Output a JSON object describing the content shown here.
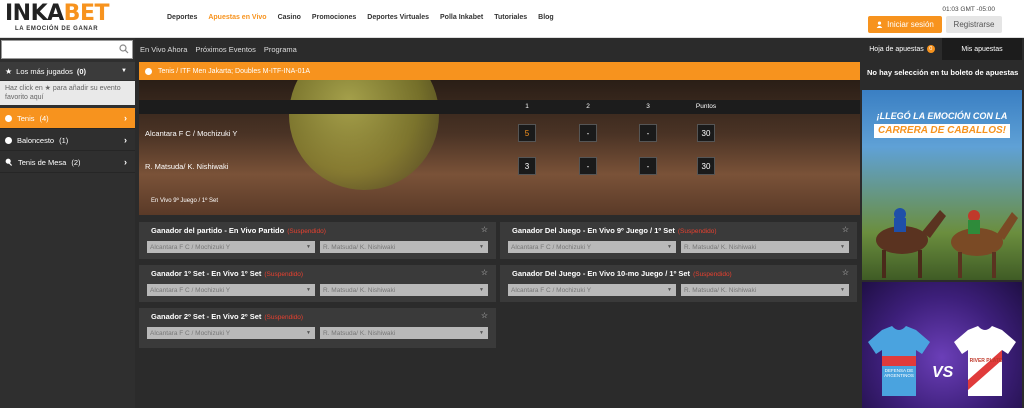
{
  "header": {
    "logo_main": "INKA",
    "logo_accent": "BET",
    "logo_tagline": "LA EMOCIÓN DE GANAR",
    "nav": [
      "Deportes",
      "Apuestas en Vivo",
      "Casino",
      "Promociones",
      "Deportes Virtuales",
      "Polla Inkabet",
      "Tutoriales",
      "Blog"
    ],
    "active_nav": "Apuestas en Vivo",
    "clock": "01:03 GMT -05:00",
    "login_label": "Iniciar sesión",
    "register_label": "Registrarse"
  },
  "sidebar": {
    "search_value": "",
    "most_played_label": "Los más jugados",
    "most_played_count": "(0)",
    "hint_text": "Haz click en ★ para añadir su evento favorito aquí",
    "sports": [
      {
        "label": "Tenis",
        "count": "(4)"
      },
      {
        "label": "Baloncesto",
        "count": "(1)"
      },
      {
        "label": "Tenis de Mesa",
        "count": "(2)"
      }
    ]
  },
  "subnav": [
    "En Vivo Ahora",
    "Próximos Eventos",
    "Programa"
  ],
  "event": {
    "title": "Tenis / ITF Men Jakarta; Doubles M-ITF-INA-01A",
    "columns": [
      "1",
      "2",
      "3",
      "Puntos"
    ],
    "players": [
      {
        "name": "Alcantara F C / Mochizuki Y",
        "scores": [
          "5",
          "-",
          "-",
          "30"
        ]
      },
      {
        "name": "R. Matsuda/ K. Nishiwaki",
        "scores": [
          "3",
          "-",
          "-",
          "30"
        ]
      }
    ],
    "live_status": "En Vivo 9º Juego / 1º Set"
  },
  "markets": [
    {
      "title": "Ganador del partido - En Vivo Partido",
      "status": "(Suspendido)",
      "options": [
        "Alcantara F C / Mochizuki Y",
        "R. Matsuda/ K. Nishiwaki"
      ]
    },
    {
      "title": "Ganador Del Juego - En Vivo 9º Juego / 1º Set",
      "status": "(Suspendido)",
      "options": [
        "Alcantara F C / Mochizuki Y",
        "R. Matsuda/ K. Nishiwaki"
      ]
    },
    {
      "title": "Ganador 1º Set - En Vivo 1º Set",
      "status": "(Suspendido)",
      "options": [
        "Alcantara F C / Mochizuki Y",
        "R. Matsuda/ K. Nishiwaki"
      ]
    },
    {
      "title": "Ganador Del Juego - En Vivo 10-mo Juego / 1º Set",
      "status": "(Suspendido)",
      "options": [
        "Alcantara F C / Mochizuki Y",
        "R. Matsuda/ K. Nishiwaki"
      ]
    },
    {
      "title": "Ganador 2º Set - En Vivo 2º Set",
      "status": "(Suspendido)",
      "options": [
        "Alcantara F C / Mochizuki Y",
        "R. Matsuda/ K. Nishiwaki"
      ]
    }
  ],
  "betslip": {
    "tab_sheet": "Hoja de apuestas",
    "tab_sheet_count": "0",
    "tab_mybets": "Mis apuestas",
    "empty_message": "No hay selección en tu boleto de apuestas"
  },
  "banners": {
    "horse_line1": "¡LLEGÓ LA EMOCIÓN CON LA",
    "horse_line2": "CARRERA DE CABALLOS!",
    "vs_text": "VS",
    "team_left": "DEFENSA DE ARGENTINOS",
    "team_right": "RIVER PLATE"
  },
  "colors": {
    "brand": "#f7931e",
    "suspended": "#e8402f",
    "dark": "#2b2b2b"
  }
}
